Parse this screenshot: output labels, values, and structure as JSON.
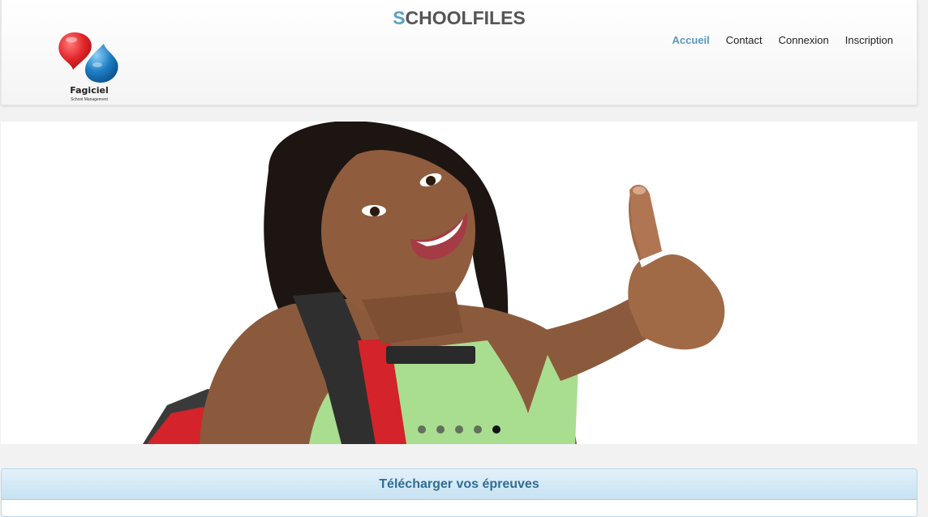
{
  "header": {
    "title_first_letter": "S",
    "title_rest": "CHOOLFILES",
    "logo_name": "Fagiciel",
    "logo_sub": "School Management"
  },
  "nav": {
    "items": [
      {
        "label": "Accueil",
        "active": true
      },
      {
        "label": "Contact",
        "active": false
      },
      {
        "label": "Connexion",
        "active": false
      },
      {
        "label": "Inscription",
        "active": false
      }
    ]
  },
  "slider": {
    "slide_count": 5,
    "active_index": 4
  },
  "panel": {
    "heading": "Télécharger vos épreuves"
  },
  "colors": {
    "accent": "#5b97bd",
    "title_accent": "#5aa0c4",
    "panel_header": "#c7e2f2",
    "panel_text": "#2f6e93",
    "logo_red": "#e3262b",
    "logo_blue": "#1f7fc4"
  }
}
